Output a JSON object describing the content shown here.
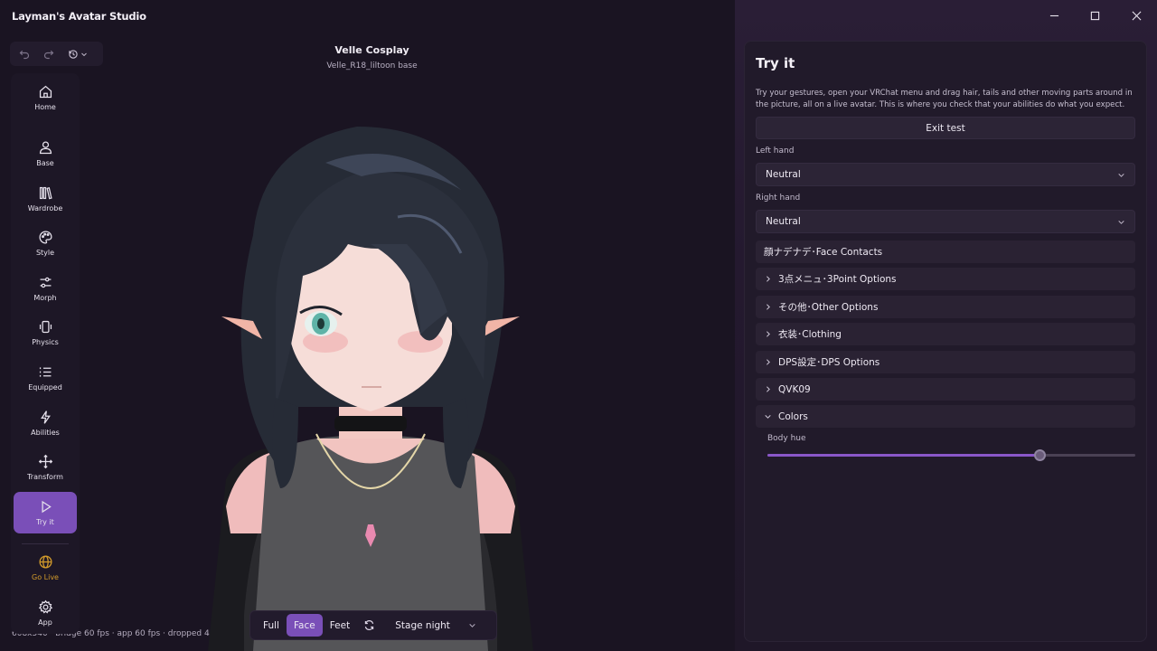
{
  "app": {
    "title": "Layman's Avatar Studio"
  },
  "viewport": {
    "title": "Velle Cosplay",
    "subtitle": "Velle_R18_liltoon base",
    "status": "608x540 · bridge 60 fps · app 60 fps · dropped 4"
  },
  "sidebar": {
    "items": [
      {
        "label": "Home",
        "icon": "home-icon"
      },
      {
        "label": "Base",
        "icon": "user-icon"
      },
      {
        "label": "Wardrobe",
        "icon": "books-icon"
      },
      {
        "label": "Style",
        "icon": "palette-icon"
      },
      {
        "label": "Morph",
        "icon": "sliders-icon"
      },
      {
        "label": "Physics",
        "icon": "vibrate-icon"
      },
      {
        "label": "Equipped",
        "icon": "list-icon"
      },
      {
        "label": "Abilities",
        "icon": "lightning-icon"
      },
      {
        "label": "Transform",
        "icon": "move-icon"
      },
      {
        "label": "Try it",
        "icon": "play-icon"
      },
      {
        "label": "Go Live",
        "icon": "globe-icon"
      },
      {
        "label": "App",
        "icon": "gear-icon"
      }
    ],
    "active_index": 9,
    "live_color": "#d39b2b",
    "accent_color": "#7a4fb8"
  },
  "toolbar": {
    "views": [
      "Full",
      "Face",
      "Feet"
    ],
    "active_view": "Face",
    "stage": "Stage night"
  },
  "panel": {
    "title": "Try it",
    "description": "Try your gestures, open your VRChat menu and drag hair, tails and other moving parts around in the picture, all on a live avatar. This is where you check that your abilities do what you expect.",
    "exit_label": "Exit test",
    "left_hand_label": "Left hand",
    "left_hand_value": "Neutral",
    "right_hand_label": "Right hand",
    "right_hand_value": "Neutral",
    "sections": [
      {
        "label": "顔ナデナデ･Face Contacts",
        "chevron": false
      },
      {
        "label": "3点メニュ･3Point Options",
        "chevron": true
      },
      {
        "label": "その他･Other Options",
        "chevron": true
      },
      {
        "label": "衣装･Clothing",
        "chevron": true
      },
      {
        "label": "DPS設定･DPS Options",
        "chevron": true
      },
      {
        "label": "QVK09",
        "chevron": true
      },
      {
        "label": "Colors",
        "chevron": true,
        "expanded": true
      }
    ],
    "slider_label": "Body hue",
    "slider_value": 0.74
  }
}
